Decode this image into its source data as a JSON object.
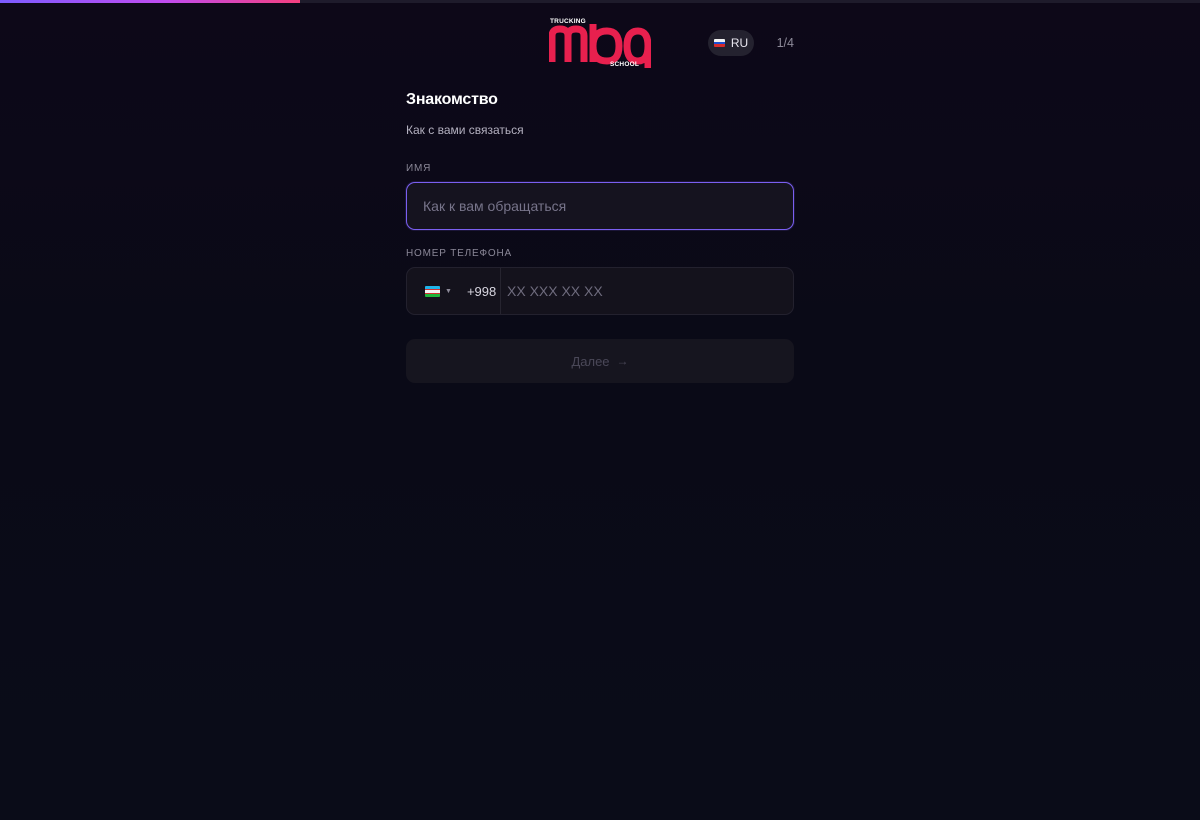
{
  "progress": {
    "value": 0.25
  },
  "header": {
    "logo": {
      "word": "mba",
      "top_text": "TRUCKING",
      "bottom_text": "SCHOOL",
      "color": "#e8204e"
    },
    "language": {
      "code": "RU",
      "flag": "flag-ru-icon"
    },
    "step": "1/4"
  },
  "form": {
    "title": "Знакомство",
    "subtitle": "Как с вами связаться",
    "name": {
      "label": "ИМЯ",
      "placeholder": "Как к вам обращаться",
      "value": ""
    },
    "phone": {
      "label": "НОМЕР ТЕЛЕФОНА",
      "country_flag": "flag-uz-icon",
      "country_code": "+998",
      "placeholder": "XX XXX XX XX",
      "value": ""
    },
    "next": {
      "label": "Далее",
      "icon": "arrow-right-icon"
    }
  },
  "colors": {
    "accent": "#7a5ff0",
    "brand": "#e8204e",
    "progress_end": "#f43f7e"
  }
}
